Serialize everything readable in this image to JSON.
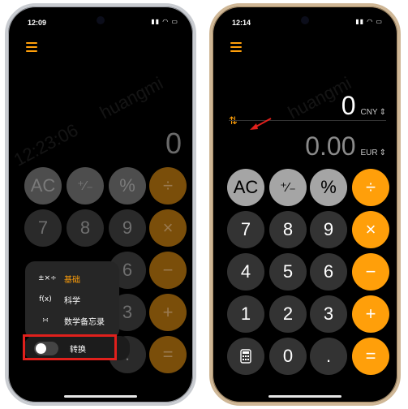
{
  "left_phone": {
    "time": "12:09",
    "display_value": "0",
    "buttons": {
      "ac": "AC",
      "plus_minus": "⁺∕₋",
      "percent": "%",
      "divide": "÷",
      "seven": "7",
      "eight": "8",
      "nine": "9",
      "multiply": "×",
      "six": "6",
      "minus": "−",
      "three": "3",
      "plus": "+",
      "dot": ".",
      "equals": "="
    },
    "menu": {
      "items": [
        {
          "icon": "±×÷",
          "label": "基础"
        },
        {
          "icon": "f(x)",
          "label": "科学"
        },
        {
          "icon": "∺",
          "label": "数学备忘录"
        }
      ],
      "toggle_label": "转换",
      "toggle_state": "off"
    }
  },
  "right_phone": {
    "time": "12:14",
    "top_value": "0",
    "top_unit": "CNY",
    "bottom_value": "0.00",
    "bottom_unit": "EUR",
    "buttons": {
      "ac": "AC",
      "plus_minus": "⁺∕₋",
      "percent": "%",
      "divide": "÷",
      "seven": "7",
      "eight": "8",
      "nine": "9",
      "multiply": "×",
      "four": "4",
      "five": "5",
      "six": "6",
      "minus": "−",
      "one": "1",
      "two": "2",
      "three": "3",
      "plus": "+",
      "zero": "0",
      "dot": ".",
      "equals": "="
    }
  },
  "watermark": {
    "text_a": "huangmi",
    "text_b": "12:23:06"
  },
  "colors": {
    "operator": "#ff9f0a",
    "digit": "#333333",
    "function": "#a5a5a5",
    "highlight": "#e0201c"
  }
}
